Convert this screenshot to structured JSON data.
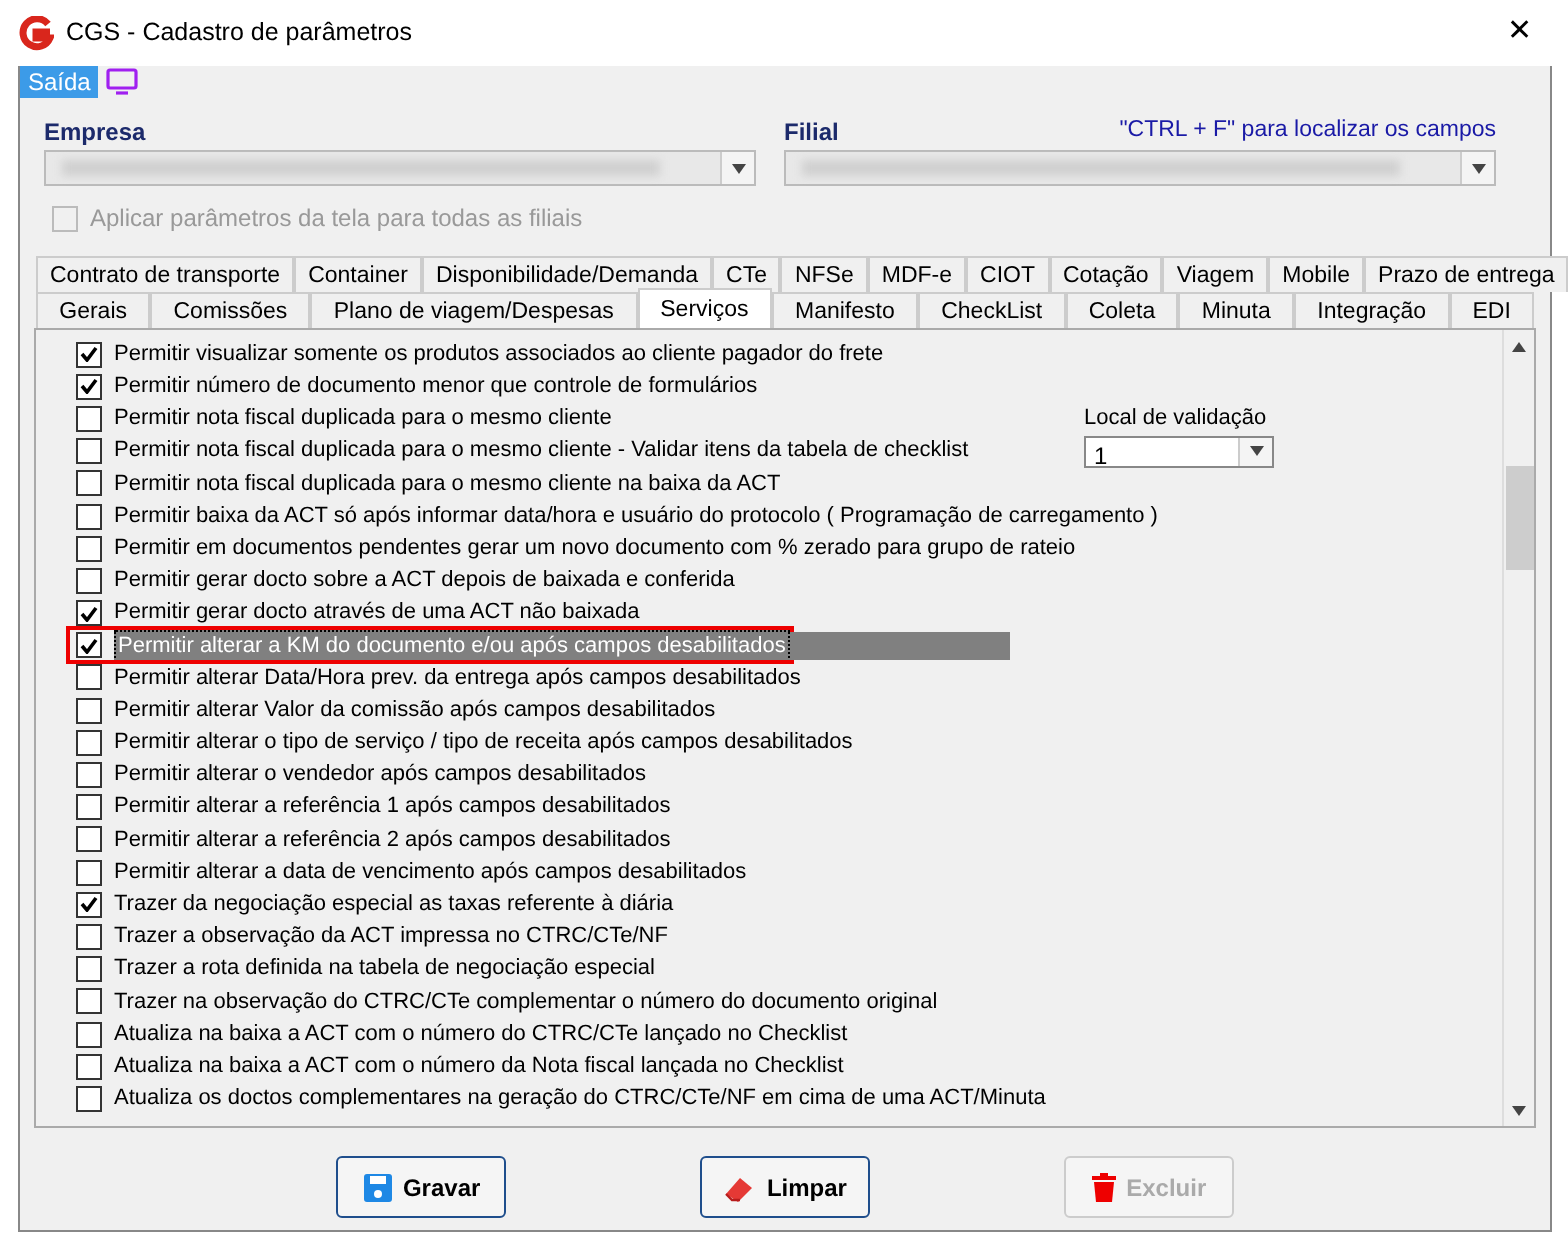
{
  "window": {
    "title": "CGS - Cadastro de parâmetros",
    "close": "✕"
  },
  "menu": [
    {
      "label": "Saída",
      "selected": true
    }
  ],
  "empresa": {
    "label": "Empresa"
  },
  "filial": {
    "label": "Filial",
    "hint": "\"CTRL + F\" para localizar os campos"
  },
  "apply_all": {
    "label": "Aplicar parâmetros da tela para todas as filiais",
    "checked": false,
    "disabled": true
  },
  "tabs_row1": [
    {
      "label": "Contrato de transporte"
    },
    {
      "label": "Container"
    },
    {
      "label": "Disponibilidade/Demanda"
    },
    {
      "label": "CTe"
    },
    {
      "label": "NFSe"
    },
    {
      "label": "MDF-e"
    },
    {
      "label": "CIOT"
    },
    {
      "label": "Cotação"
    },
    {
      "label": "Viagem"
    },
    {
      "label": "Mobile"
    },
    {
      "label": "Prazo de entrega"
    }
  ],
  "tabs_row2": [
    {
      "label": "Gerais",
      "selected": false
    },
    {
      "label": "Comissões",
      "selected": false
    },
    {
      "label": "Plano de viagem/Despesas",
      "selected": false
    },
    {
      "label": "Serviços",
      "selected": true
    },
    {
      "label": "Manifesto",
      "selected": false
    },
    {
      "label": "CheckList",
      "selected": false
    },
    {
      "label": "Coleta",
      "selected": false
    },
    {
      "label": "Minuta",
      "selected": false
    },
    {
      "label": "Integração",
      "selected": false
    },
    {
      "label": "EDI",
      "selected": false
    }
  ],
  "options": [
    {
      "label": "Permitir visualizar somente os produtos associados ao cliente pagador do frete",
      "checked": true,
      "selected": false
    },
    {
      "label": "Permitir número de documento menor que controle de formulários",
      "checked": true,
      "selected": false
    },
    {
      "label": "Permitir nota fiscal duplicada para o mesmo cliente",
      "checked": false,
      "selected": false
    },
    {
      "label": "Permitir nota fiscal duplicada para o mesmo cliente - Validar itens da tabela de checklist",
      "checked": false,
      "selected": false
    },
    {
      "label": "Permitir nota fiscal duplicada para o mesmo cliente na baixa da ACT",
      "checked": false,
      "selected": false
    },
    {
      "label": "Permitir baixa da ACT só após informar data/hora e usuário do protocolo ( Programação de carregamento )",
      "checked": false,
      "selected": false
    },
    {
      "label": "Permitir em documentos pendentes gerar um novo documento com % zerado para grupo de rateio",
      "checked": false,
      "selected": false
    },
    {
      "label": "Permitir gerar docto sobre a ACT depois de baixada e conferida",
      "checked": false,
      "selected": false
    },
    {
      "label": "Permitir gerar docto através de uma ACT não baixada",
      "checked": true,
      "selected": false
    },
    {
      "label": "Permitir alterar a KM do documento e/ou após campos desabilitados",
      "checked": true,
      "selected": true,
      "highlighted": true
    },
    {
      "label": "Permitir alterar Data/Hora prev. da entrega após campos desabilitados",
      "checked": false,
      "selected": false
    },
    {
      "label": "Permitir alterar Valor da comissão após campos desabilitados",
      "checked": false,
      "selected": false
    },
    {
      "label": "Permitir alterar o tipo de serviço / tipo de receita após campos desabilitados",
      "checked": false,
      "selected": false
    },
    {
      "label": "Permitir alterar o vendedor após campos desabilitados",
      "checked": false,
      "selected": false
    },
    {
      "label": "Permitir alterar a referência 1 após campos desabilitados",
      "checked": false,
      "selected": false
    },
    {
      "label": "Permitir alterar a referência 2 após campos desabilitados",
      "checked": false,
      "selected": false
    },
    {
      "label": "Permitir alterar a data de vencimento após campos desabilitados",
      "checked": false,
      "selected": false
    },
    {
      "label": "Trazer da negociação especial as taxas referente à diária",
      "checked": true,
      "selected": false
    },
    {
      "label": "Trazer a observação da ACT impressa no CTRC/CTe/NF",
      "checked": false,
      "selected": false
    },
    {
      "label": "Trazer a rota definida na tabela de negociação especial",
      "checked": false,
      "selected": false
    },
    {
      "label": "Trazer na observação do CTRC/CTe complementar o número do documento original",
      "checked": false,
      "selected": false
    },
    {
      "label": "Atualiza na baixa a ACT com o número do CTRC/CTe lançado no Checklist",
      "checked": false,
      "selected": false
    },
    {
      "label": "Atualiza na baixa a ACT com o número da Nota fiscal lançada no Checklist",
      "checked": false,
      "selected": false
    },
    {
      "label": "Atualiza os doctos complementares na geração do CTRC/CTe/NF em cima de uma ACT/Minuta",
      "checked": false,
      "selected": false
    }
  ],
  "local_validacao": {
    "label": "Local de validação",
    "value": "1"
  },
  "buttons": [
    {
      "label": "Gravar",
      "kind": "save",
      "disabled": false
    },
    {
      "label": "Limpar",
      "kind": "clear",
      "disabled": false
    },
    {
      "label": "Excluir",
      "kind": "delete",
      "disabled": true
    }
  ]
}
